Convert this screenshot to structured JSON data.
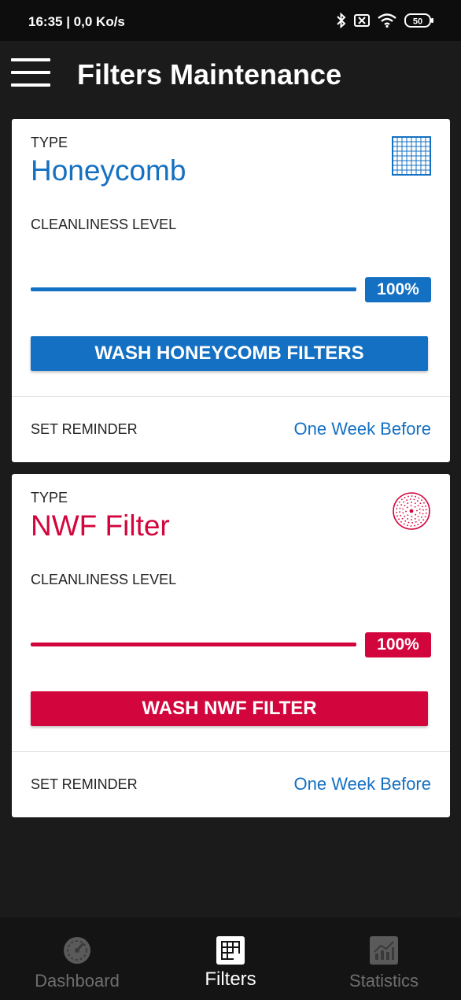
{
  "status_bar": {
    "time": "16:35 | 0,0 Ko/s",
    "battery": "50"
  },
  "app_bar": {
    "title": "Filters Maintenance",
    "menu_icon": "hamburger-menu-icon"
  },
  "filters": [
    {
      "type_label": "TYPE",
      "type_name": "Honeycomb",
      "icon": "honeycomb-grid-icon",
      "cleanliness_label": "CLEANLINESS LEVEL",
      "cleanliness_percent": "100%",
      "cleanliness_fraction": 1.0,
      "wash_button": "WASH HONEYCOMB FILTERS",
      "reminder_label": "SET REMINDER",
      "reminder_value": "One Week Before",
      "accent_color": "#1470c2"
    },
    {
      "type_label": "TYPE",
      "type_name": "NWF Filter",
      "icon": "nwf-dotted-circle-icon",
      "cleanliness_label": "CLEANLINESS LEVEL",
      "cleanliness_percent": "100%",
      "cleanliness_fraction": 1.0,
      "wash_button": "WASH NWF FILTER",
      "reminder_label": "SET REMINDER",
      "reminder_value": "One Week Before",
      "accent_color": "#d2063c"
    }
  ],
  "bottom_nav": [
    {
      "label": "Dashboard",
      "icon": "gauge-icon",
      "active": false
    },
    {
      "label": "Filters",
      "icon": "filter-grid-icon",
      "active": true
    },
    {
      "label": "Statistics",
      "icon": "chart-icon",
      "active": false
    }
  ]
}
